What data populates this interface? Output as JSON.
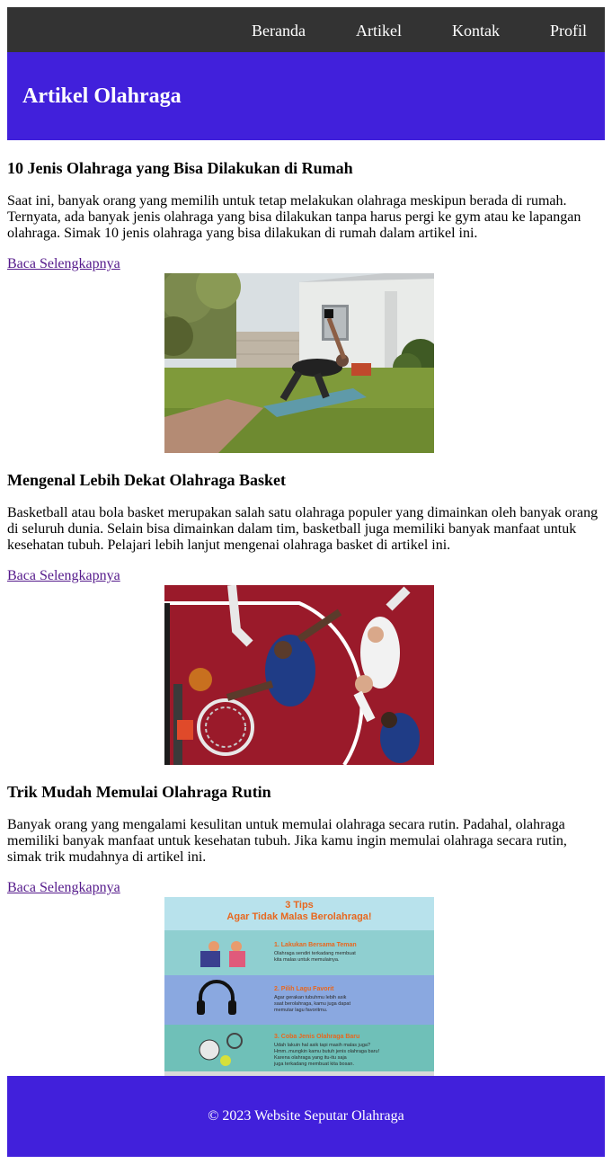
{
  "nav": {
    "items": [
      {
        "label": "Beranda"
      },
      {
        "label": "Artikel"
      },
      {
        "label": "Kontak"
      },
      {
        "label": "Profil"
      }
    ]
  },
  "header": {
    "title": "Artikel Olahraga"
  },
  "articles": [
    {
      "title": "10 Jenis Olahraga yang Bisa Dilakukan di Rumah",
      "summary": "Saat ini, banyak orang yang memilih untuk tetap melakukan olahraga meskipun berada di rumah. Ternyata, ada banyak jenis olahraga yang bisa dilakukan tanpa harus pergi ke gym atau ke lapangan olahraga. Simak 10 jenis olahraga yang bisa dilakukan di rumah dalam artikel ini.",
      "link": "Baca Selengkapnya"
    },
    {
      "title": "Mengenal Lebih Dekat Olahraga Basket",
      "summary": "Basketball atau bola basket merupakan salah satu olahraga populer yang dimainkan oleh banyak orang di seluruh dunia. Selain bisa dimainkan dalam tim, basketball juga memiliki banyak manfaat untuk kesehatan tubuh. Pelajari lebih lanjut mengenai olahraga basket di artikel ini.",
      "link": "Baca Selengkapnya"
    },
    {
      "title": "Trik Mudah Memulai Olahraga Rutin",
      "summary": "Banyak orang yang mengalami kesulitan untuk memulai olahraga secara rutin. Padahal, olahraga memiliki banyak manfaat untuk kesehatan tubuh. Jika kamu ingin memulai olahraga secara rutin, simak trik mudahnya di artikel ini.",
      "link": "Baca Selengkapnya"
    }
  ],
  "infographic": {
    "title_line1": "3 Tips",
    "title_line2": "Agar Tidak Malas Berolahraga!",
    "tips": [
      {
        "heading": "1. Lakukan Bersama Teman",
        "text_line1": "Olahraga sendiri terkadang membuat",
        "text_line2": "kita malas untuk memulainya."
      },
      {
        "heading": "2. Pilih Lagu Favorit",
        "text_line1": "Agar gerakan tubuhmu lebih asik",
        "text_line2": "saat berolahraga, kamu juga dapat",
        "text_line3": "memutar lagu favoritmu."
      },
      {
        "heading": "3. Coba Jenis Olahraga Baru",
        "text_line1": "Udah lakuin hal asik tapi masih malas juga?",
        "text_line2": "Hmm..mungkin kamu butuh jenis olahraga baru!",
        "text_line3": "Karena olahraga yang itu-itu saja",
        "text_line4": "juga terkadang membuat kita bosan."
      }
    ]
  },
  "footer": {
    "text": "© 2023 Website Seputar Olahraga"
  },
  "colors": {
    "nav_bg": "#333333",
    "brand": "#4120db",
    "link_visited": "#551a8b"
  }
}
